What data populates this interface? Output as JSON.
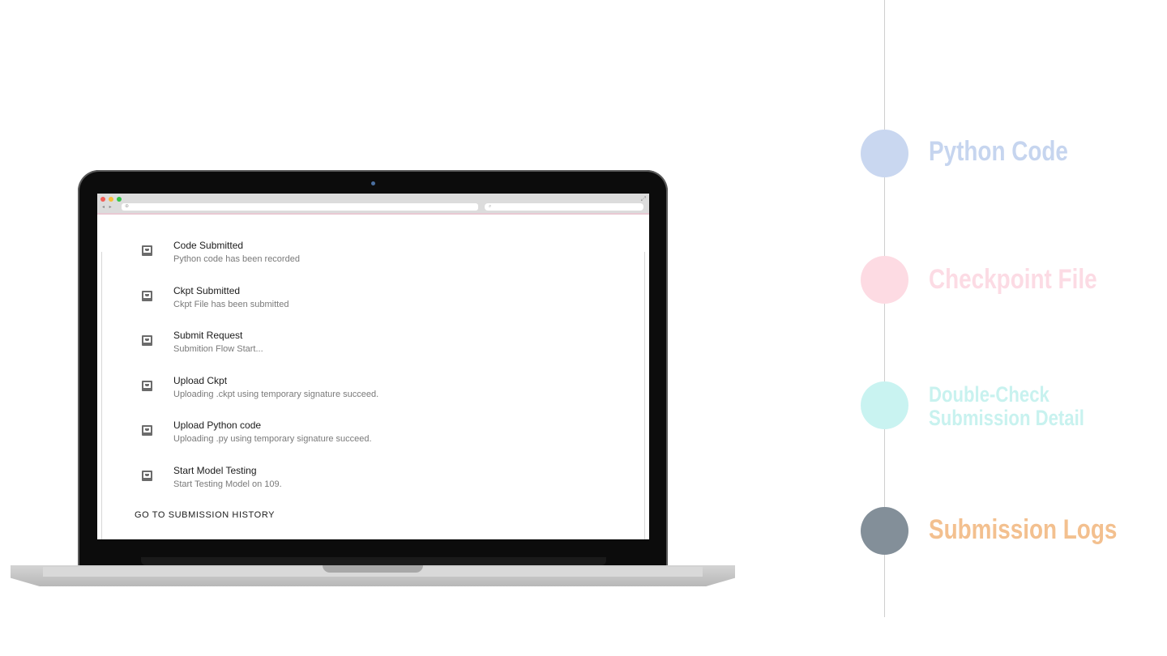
{
  "browser": {
    "nav_arrows": "◂ ▸",
    "url_text": "⊕",
    "search_text": "⌕",
    "expand_icon": "⤢"
  },
  "logs": [
    {
      "title": "Code Submitted",
      "description": "Python code has been recorded"
    },
    {
      "title": "Ckpt Submitted",
      "description": "Ckpt File has been submitted"
    },
    {
      "title": "Submit Request",
      "description": "Submition Flow Start..."
    },
    {
      "title": "Upload Ckpt",
      "description": "Uploading .ckpt using temporary signature succeed."
    },
    {
      "title": "Upload Python code",
      "description": "Uploading .py using temporary signature succeed."
    },
    {
      "title": "Start Model Testing",
      "description": "Start Testing Model on 109."
    }
  ],
  "history_link": "GO TO SUBMISSION HISTORY",
  "timeline": {
    "steps": [
      {
        "label": "Python Code",
        "dot_color": "#c9d7f0",
        "text_color": "#c6d5ef"
      },
      {
        "label": "Checkpoint File",
        "dot_color": "#fddbe3",
        "text_color": "#fcdbe4"
      },
      {
        "label_line1": "Double-Check",
        "label_line2": "Submission Detail",
        "dot_color": "#c9f3f1",
        "text_color": "#c8f2ef"
      },
      {
        "label": "Submission Logs",
        "dot_color": "#838f99",
        "text_color": "#f3c08f"
      }
    ]
  }
}
